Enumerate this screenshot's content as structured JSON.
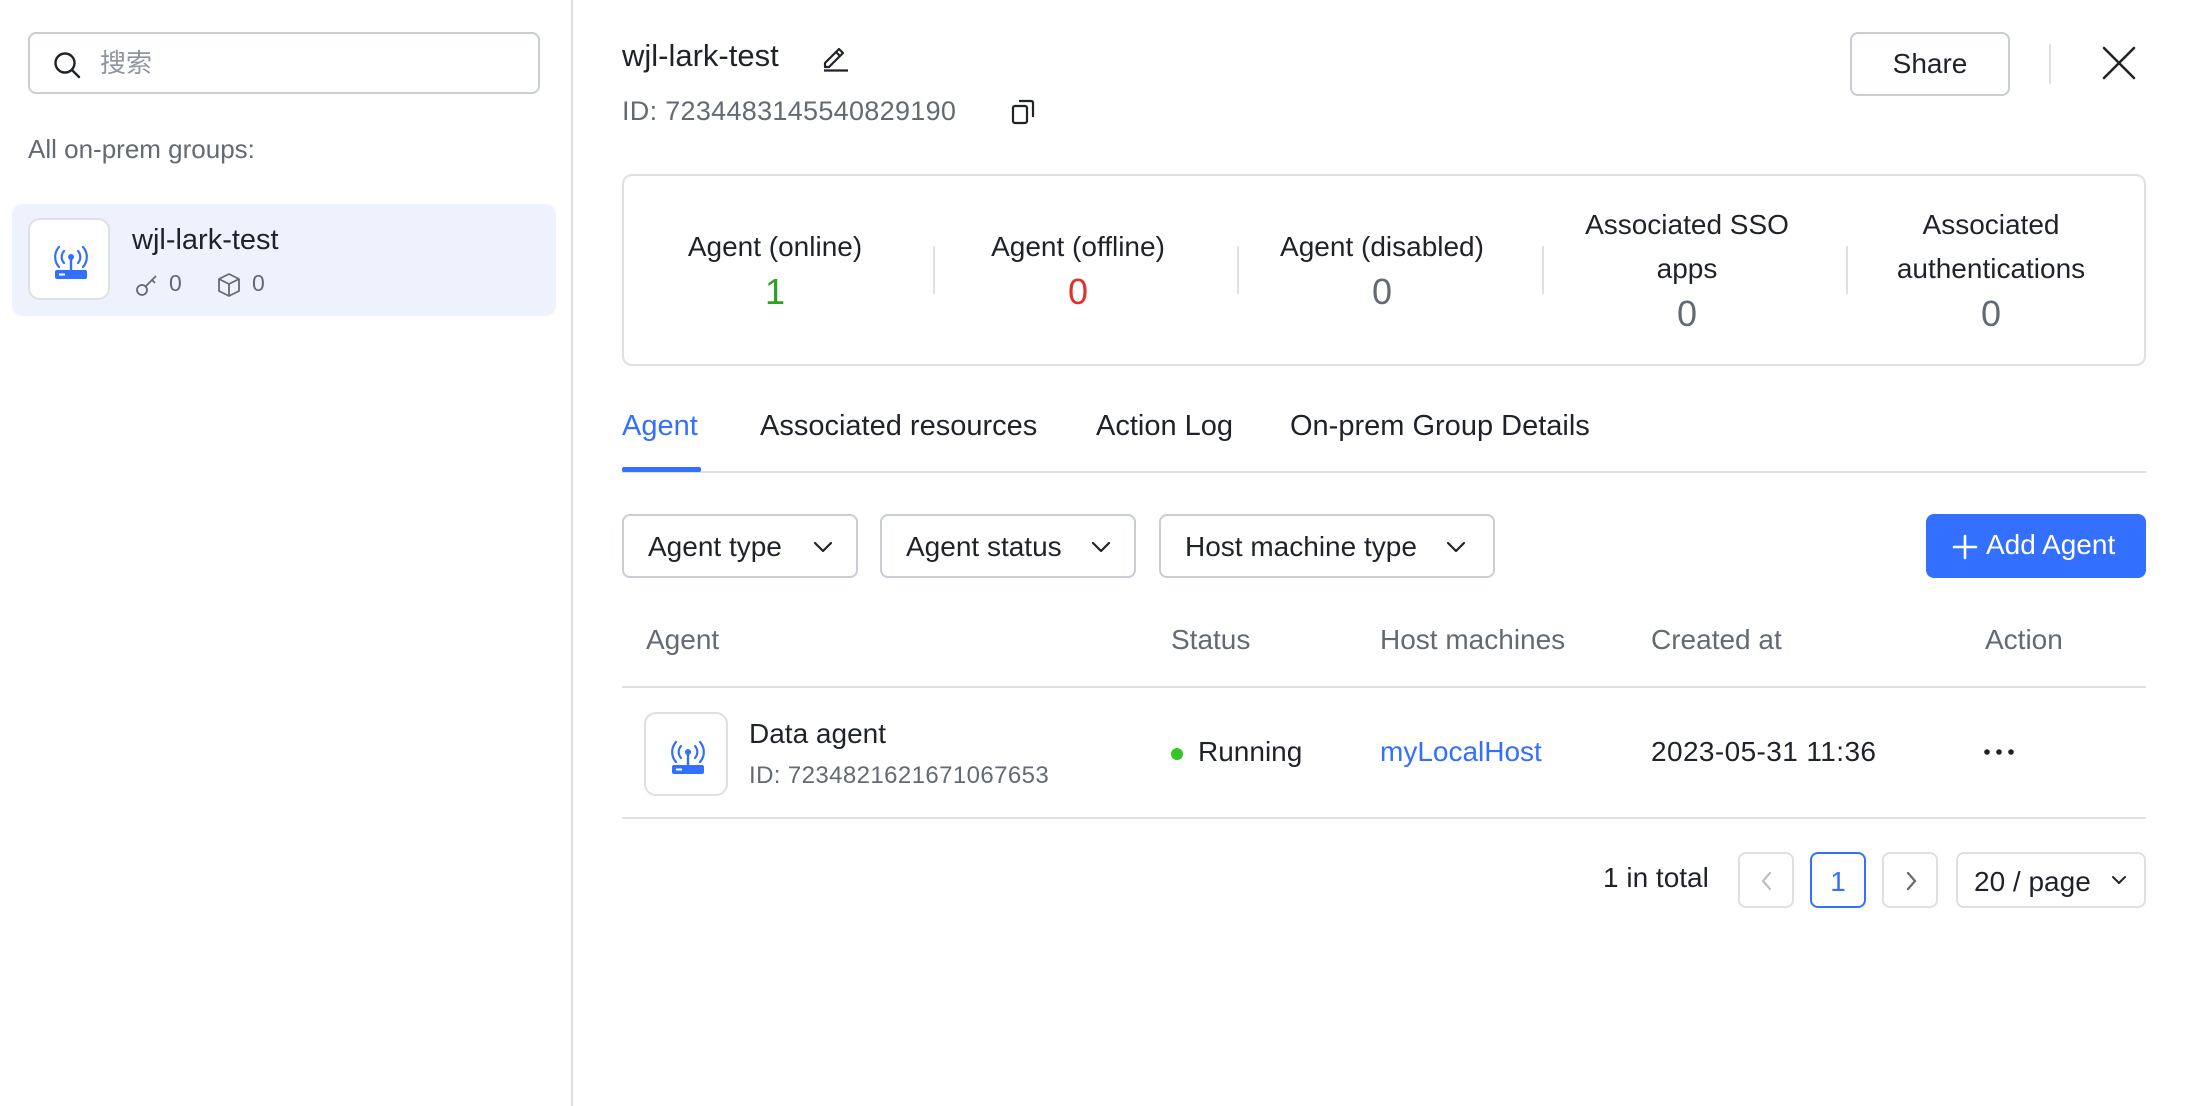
{
  "sidebar": {
    "search_placeholder": "搜索",
    "groups_label": "All on-prem groups:",
    "groups": [
      {
        "name": "wjl-lark-test",
        "key_count": "0",
        "resource_count": "0",
        "selected": true
      }
    ]
  },
  "header": {
    "title": "wjl-lark-test",
    "id_text": "ID: 7234483145540829190",
    "share_label": "Share"
  },
  "stats": [
    {
      "label": "Agent (online)",
      "value": "1",
      "color": "#2ea121"
    },
    {
      "label": "Agent (offline)",
      "value": "0",
      "color": "#e0322c"
    },
    {
      "label": "Agent (disabled)",
      "value": "0",
      "color": "#646a73"
    },
    {
      "label": "Associated SSO apps",
      "value": "0",
      "color": "#646a73"
    },
    {
      "label": "Associated authentications",
      "value": "0",
      "color": "#646a73"
    }
  ],
  "tabs": [
    {
      "label": "Agent",
      "active": true
    },
    {
      "label": "Associated resources"
    },
    {
      "label": "Action Log"
    },
    {
      "label": "On-prem Group Details"
    }
  ],
  "filters": {
    "agent_type": "Agent type",
    "agent_status": "Agent status",
    "host_machine_type": "Host machine type",
    "add_agent": "Add Agent"
  },
  "table": {
    "columns": [
      "Agent",
      "Status",
      "Host machines",
      "Created at",
      "Action"
    ],
    "rows": [
      {
        "name": "Data agent",
        "id_text": "ID: 7234821621671067653",
        "status": "Running",
        "status_color": "#34c724",
        "host": "myLocalHost",
        "created_at": "2023-05-31 11:36"
      }
    ]
  },
  "pagination": {
    "total_text": "1 in total",
    "current_page": "1",
    "page_size": "20 / page"
  },
  "colors": {
    "accent": "#3370ff",
    "selected_bg": "#eef2fd",
    "border": "#dee0e3"
  },
  "icons": {
    "search": "search-icon",
    "edit": "edit-icon",
    "copy": "copy-icon",
    "close": "close-icon",
    "agent": "router-icon",
    "key": "key-icon",
    "box": "box-icon",
    "more": "more-icon"
  }
}
